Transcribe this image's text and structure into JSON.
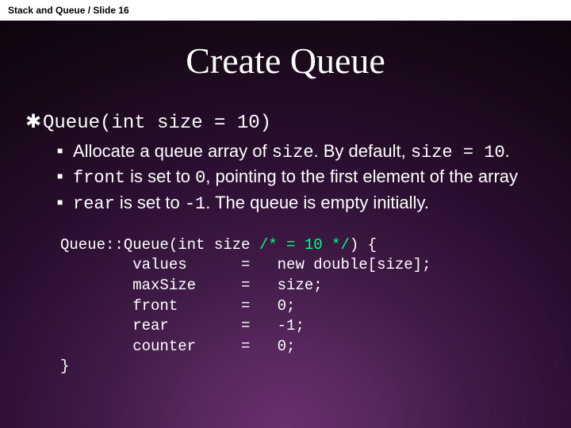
{
  "header_label": "Stack and Queue / Slide 16",
  "title": "Create Queue",
  "bullet1": "Queue(int size = 10)",
  "sub": {
    "b1_a": "Allocate a queue array of ",
    "b1_b": "size",
    "b1_c": ". By default, ",
    "b1_d": "size = 10",
    "b1_e": ".",
    "b2_a": "front",
    "b2_b": " is set to ",
    "b2_c": "0",
    "b2_d": ", pointing to the first element of the array",
    "b3_a": "rear",
    "b3_b": " is set to ",
    "b3_c": "-1",
    "b3_d": ". The queue is empty initially."
  },
  "code": {
    "l1_a": "Queue::Queue(int size ",
    "l1_b": "/* = 10 */",
    "l1_c": ") {",
    "l2": "        values      =   new double[size];",
    "l3": "        maxSize     =   size;",
    "l4": "        front       =   0;",
    "l5": "        rear        =   -1;",
    "l6": "        counter     =   0;",
    "l7": "}"
  }
}
